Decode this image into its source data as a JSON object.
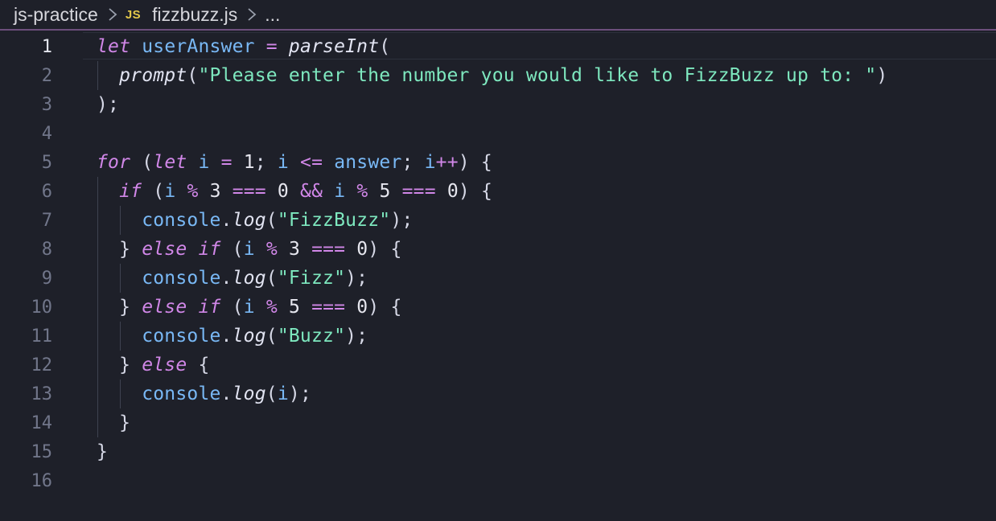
{
  "breadcrumb": {
    "folder": "js-practice",
    "file_badge": "JS",
    "file": "fizzbuzz.js",
    "more": "..."
  },
  "editor": {
    "active_line": 1,
    "lines": [
      {
        "n": "1",
        "tokens": [
          [
            "kw",
            "let"
          ],
          [
            "pun",
            " "
          ],
          [
            "var",
            "userAnswer"
          ],
          [
            "pun",
            " "
          ],
          [
            "op",
            "="
          ],
          [
            "pun",
            " "
          ],
          [
            "fn",
            "parseInt"
          ],
          [
            "pun",
            "("
          ]
        ]
      },
      {
        "n": "2",
        "tokens": [
          [
            "pun",
            "  "
          ],
          [
            "fn",
            "prompt"
          ],
          [
            "pun",
            "("
          ],
          [
            "str",
            "\"Please enter the number you would like to FizzBuzz up to: \""
          ],
          [
            "pun",
            ")"
          ]
        ]
      },
      {
        "n": "3",
        "tokens": [
          [
            "pun",
            ");"
          ]
        ]
      },
      {
        "n": "4",
        "tokens": []
      },
      {
        "n": "5",
        "tokens": [
          [
            "kw",
            "for"
          ],
          [
            "pun",
            " ("
          ],
          [
            "kw",
            "let"
          ],
          [
            "pun",
            " "
          ],
          [
            "var",
            "i"
          ],
          [
            "pun",
            " "
          ],
          [
            "op",
            "="
          ],
          [
            "pun",
            " "
          ],
          [
            "num",
            "1"
          ],
          [
            "pun",
            "; "
          ],
          [
            "var",
            "i"
          ],
          [
            "pun",
            " "
          ],
          [
            "op",
            "<="
          ],
          [
            "pun",
            " "
          ],
          [
            "var",
            "answer"
          ],
          [
            "pun",
            "; "
          ],
          [
            "var",
            "i"
          ],
          [
            "op",
            "++"
          ],
          [
            "pun",
            ") {"
          ]
        ]
      },
      {
        "n": "6",
        "tokens": [
          [
            "pun",
            "  "
          ],
          [
            "kw",
            "if"
          ],
          [
            "pun",
            " ("
          ],
          [
            "var",
            "i"
          ],
          [
            "pun",
            " "
          ],
          [
            "op",
            "%"
          ],
          [
            "pun",
            " "
          ],
          [
            "num",
            "3"
          ],
          [
            "pun",
            " "
          ],
          [
            "op",
            "==="
          ],
          [
            "pun",
            " "
          ],
          [
            "num",
            "0"
          ],
          [
            "pun",
            " "
          ],
          [
            "op",
            "&&"
          ],
          [
            "pun",
            " "
          ],
          [
            "var",
            "i"
          ],
          [
            "pun",
            " "
          ],
          [
            "op",
            "%"
          ],
          [
            "pun",
            " "
          ],
          [
            "num",
            "5"
          ],
          [
            "pun",
            " "
          ],
          [
            "op",
            "==="
          ],
          [
            "pun",
            " "
          ],
          [
            "num",
            "0"
          ],
          [
            "pun",
            ") {"
          ]
        ]
      },
      {
        "n": "7",
        "tokens": [
          [
            "pun",
            "    "
          ],
          [
            "obj",
            "console"
          ],
          [
            "pun",
            "."
          ],
          [
            "fn",
            "log"
          ],
          [
            "pun",
            "("
          ],
          [
            "str",
            "\"FizzBuzz\""
          ],
          [
            "pun",
            ");"
          ]
        ]
      },
      {
        "n": "8",
        "tokens": [
          [
            "pun",
            "  } "
          ],
          [
            "kw",
            "else"
          ],
          [
            "pun",
            " "
          ],
          [
            "kw",
            "if"
          ],
          [
            "pun",
            " ("
          ],
          [
            "var",
            "i"
          ],
          [
            "pun",
            " "
          ],
          [
            "op",
            "%"
          ],
          [
            "pun",
            " "
          ],
          [
            "num",
            "3"
          ],
          [
            "pun",
            " "
          ],
          [
            "op",
            "==="
          ],
          [
            "pun",
            " "
          ],
          [
            "num",
            "0"
          ],
          [
            "pun",
            ") {"
          ]
        ]
      },
      {
        "n": "9",
        "tokens": [
          [
            "pun",
            "    "
          ],
          [
            "obj",
            "console"
          ],
          [
            "pun",
            "."
          ],
          [
            "fn",
            "log"
          ],
          [
            "pun",
            "("
          ],
          [
            "str",
            "\"Fizz\""
          ],
          [
            "pun",
            ");"
          ]
        ]
      },
      {
        "n": "10",
        "tokens": [
          [
            "pun",
            "  } "
          ],
          [
            "kw",
            "else"
          ],
          [
            "pun",
            " "
          ],
          [
            "kw",
            "if"
          ],
          [
            "pun",
            " ("
          ],
          [
            "var",
            "i"
          ],
          [
            "pun",
            " "
          ],
          [
            "op",
            "%"
          ],
          [
            "pun",
            " "
          ],
          [
            "num",
            "5"
          ],
          [
            "pun",
            " "
          ],
          [
            "op",
            "==="
          ],
          [
            "pun",
            " "
          ],
          [
            "num",
            "0"
          ],
          [
            "pun",
            ") {"
          ]
        ]
      },
      {
        "n": "11",
        "tokens": [
          [
            "pun",
            "    "
          ],
          [
            "obj",
            "console"
          ],
          [
            "pun",
            "."
          ],
          [
            "fn",
            "log"
          ],
          [
            "pun",
            "("
          ],
          [
            "str",
            "\"Buzz\""
          ],
          [
            "pun",
            ");"
          ]
        ]
      },
      {
        "n": "12",
        "tokens": [
          [
            "pun",
            "  } "
          ],
          [
            "kw",
            "else"
          ],
          [
            "pun",
            " {"
          ]
        ]
      },
      {
        "n": "13",
        "tokens": [
          [
            "pun",
            "    "
          ],
          [
            "obj",
            "console"
          ],
          [
            "pun",
            "."
          ],
          [
            "fn",
            "log"
          ],
          [
            "pun",
            "("
          ],
          [
            "var",
            "i"
          ],
          [
            "pun",
            ");"
          ]
        ]
      },
      {
        "n": "14",
        "tokens": [
          [
            "pun",
            "  }"
          ]
        ]
      },
      {
        "n": "15",
        "tokens": [
          [
            "pun",
            "}"
          ]
        ]
      },
      {
        "n": "16",
        "tokens": []
      }
    ]
  },
  "colors": {
    "background": "#1e2029",
    "keyword": "#d187e8",
    "variable": "#79b8f5",
    "string": "#7ee8bf",
    "text": "#d6d8e6",
    "line_number": "#71768a",
    "breadcrumb_border": "#6c4f7c",
    "js_badge": "#e3c84a"
  }
}
